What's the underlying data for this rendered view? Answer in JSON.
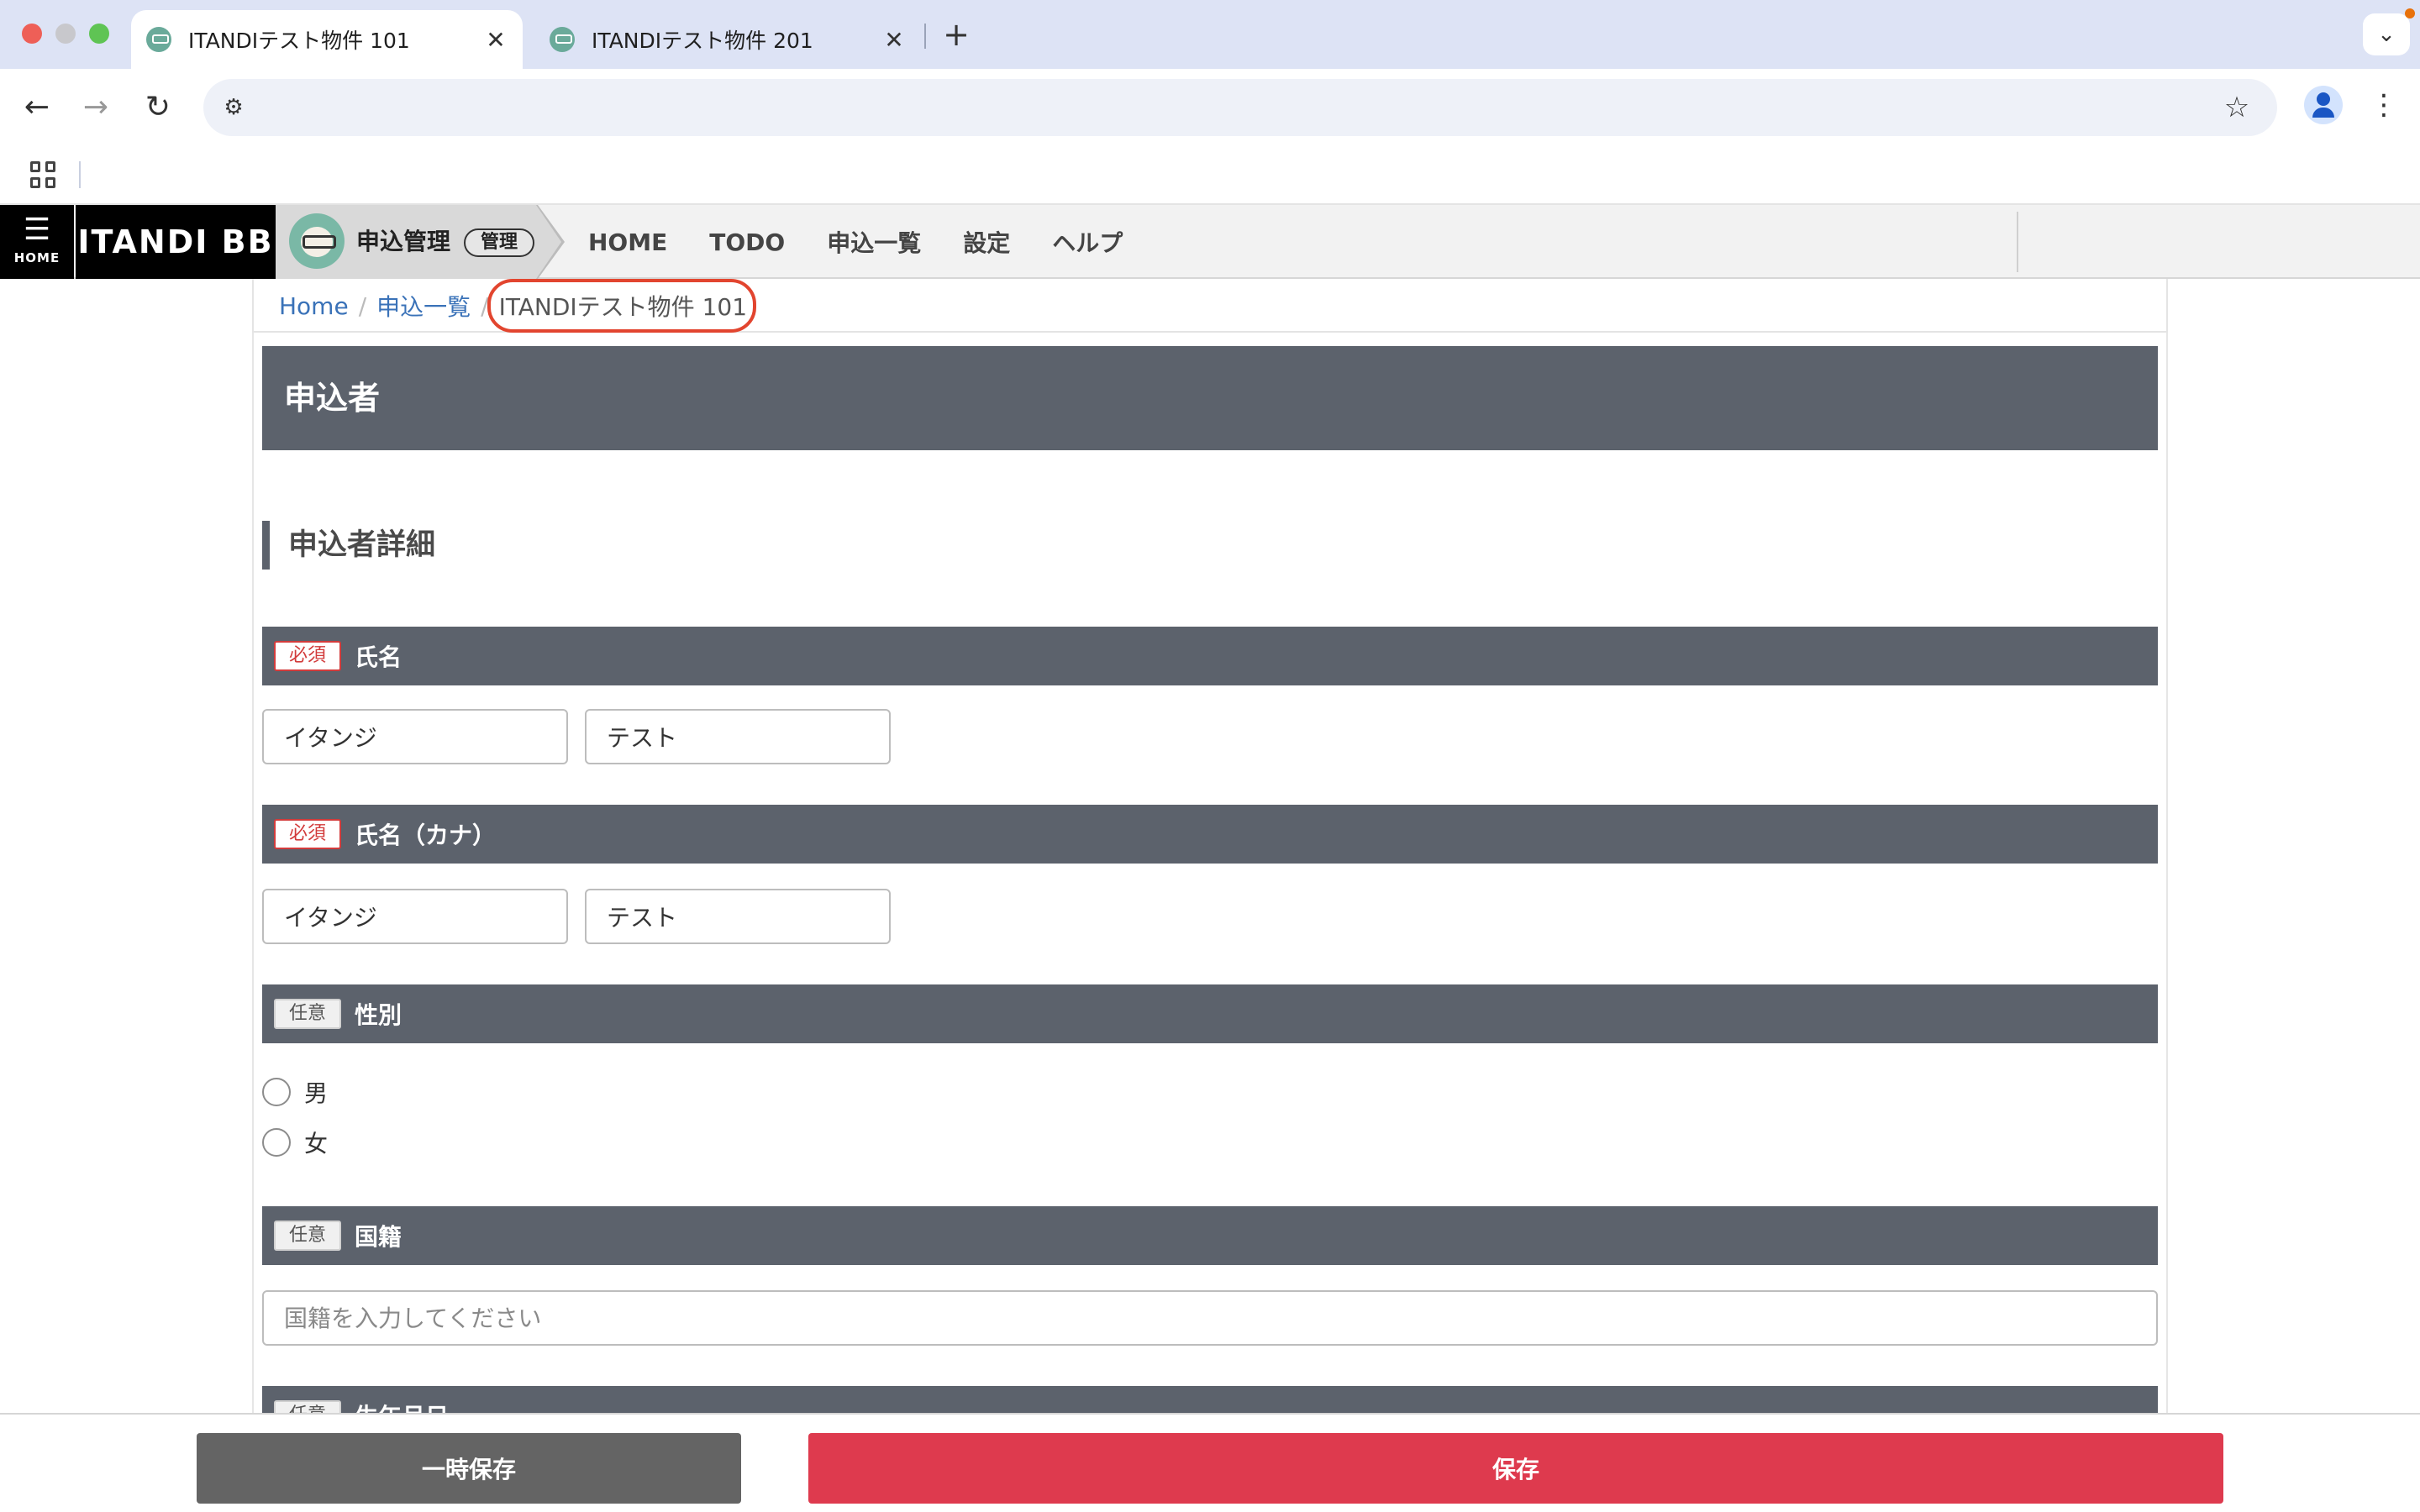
{
  "browser": {
    "tabs": [
      {
        "title": "ITANDIテスト物件 101",
        "active": true
      },
      {
        "title": "ITANDIテスト物件 201",
        "active": false
      }
    ],
    "close_glyph": "✕",
    "new_tab_glyph": "+",
    "url": ""
  },
  "app": {
    "menu_label": "HOME",
    "brand": "ITANDI BB",
    "product": "申込管理",
    "role_badge": "管理",
    "nav": [
      "HOME",
      "TODO",
      "申込一覧",
      "設定",
      "ヘルプ"
    ]
  },
  "breadcrumb": {
    "items": [
      "Home",
      "申込一覧"
    ],
    "current": "ITANDIテスト物件 101"
  },
  "section": {
    "title": "申込者",
    "subtitle": "申込者詳細"
  },
  "fields": {
    "name": {
      "badge": "必須",
      "label": "氏名",
      "last": "イタンジ",
      "first": "テスト"
    },
    "kana": {
      "badge": "必須",
      "label": "氏名（カナ）",
      "last": "イタンジ",
      "first": "テスト"
    },
    "gender": {
      "badge": "任意",
      "label": "性別",
      "options": [
        "男",
        "女"
      ]
    },
    "nationality": {
      "badge": "任意",
      "label": "国籍",
      "value": "",
      "placeholder": "国籍を入力してください"
    },
    "birthdate": {
      "badge": "任意",
      "label": "生年月日"
    }
  },
  "actions": {
    "temp_save": "一時保存",
    "save": "保存"
  },
  "colors": {
    "section_bar": "#5c626c",
    "save_button": "#de3a4e",
    "temp_button": "#646464",
    "highlight": "#e2452f",
    "link": "#3a72b8"
  }
}
